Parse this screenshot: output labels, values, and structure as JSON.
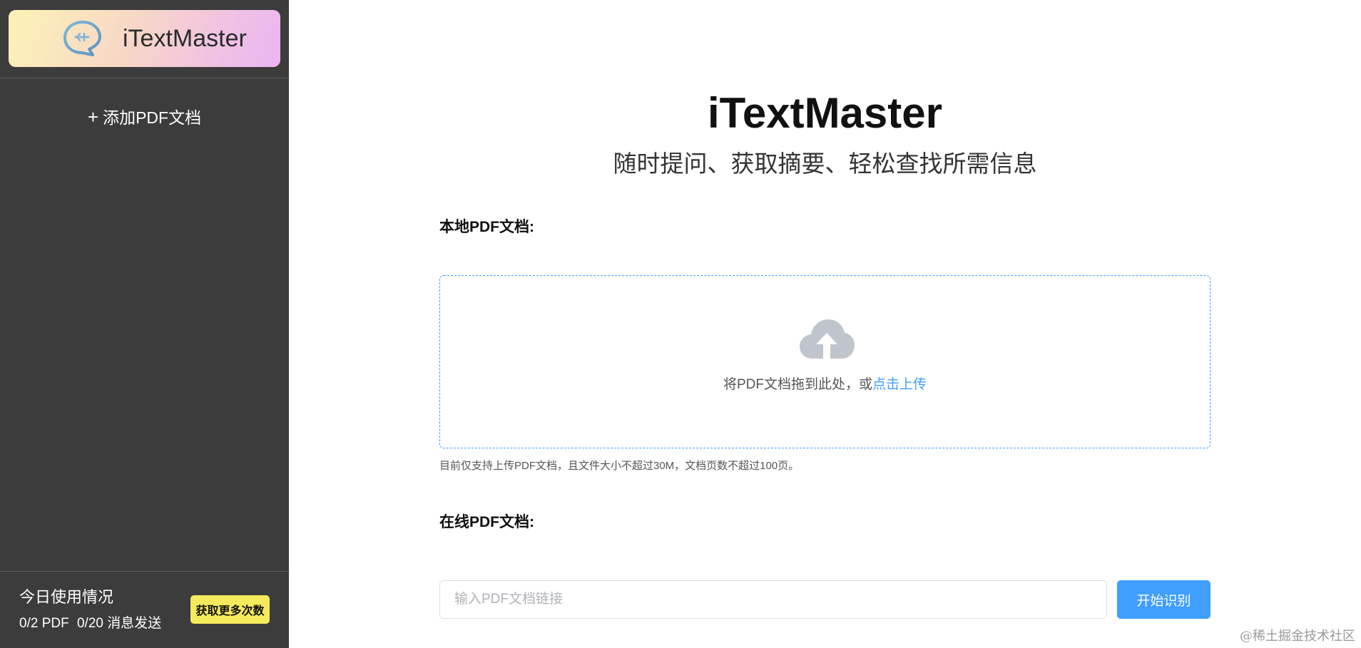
{
  "sidebar": {
    "logo_title": "iTextMaster",
    "add_pdf_label": "添加PDF文档",
    "usage": {
      "title": "今日使用情况",
      "pdf_count": "0/2 PDF",
      "message_count": "0/20 消息发送",
      "more_button_label": "获取更多次数"
    }
  },
  "main": {
    "title": "iTextMaster",
    "subtitle": "随时提问、获取摘要、轻松查找所需信息",
    "local_section": {
      "label": "本地PDF文档:",
      "drop_text": "将PDF文档拖到此处，或",
      "upload_link": "点击上传",
      "tip": "目前仅支持上传PDF文档，且文件大小不超过30M，文档页数不超过100页。"
    },
    "online_section": {
      "label": "在线PDF文档:",
      "input_placeholder": "输入PDF文档链接",
      "input_value": "",
      "start_button_label": "开始识别"
    }
  },
  "watermark": "@稀土掘金技术社区",
  "colors": {
    "sidebar_bg": "#3c3c3c",
    "accent": "#409eff",
    "more_button_bg": "#f5ea5c"
  },
  "icons": {
    "logo": "chat-bubble-q-icon",
    "add": "plus-icon",
    "upload": "cloud-upload-icon"
  }
}
